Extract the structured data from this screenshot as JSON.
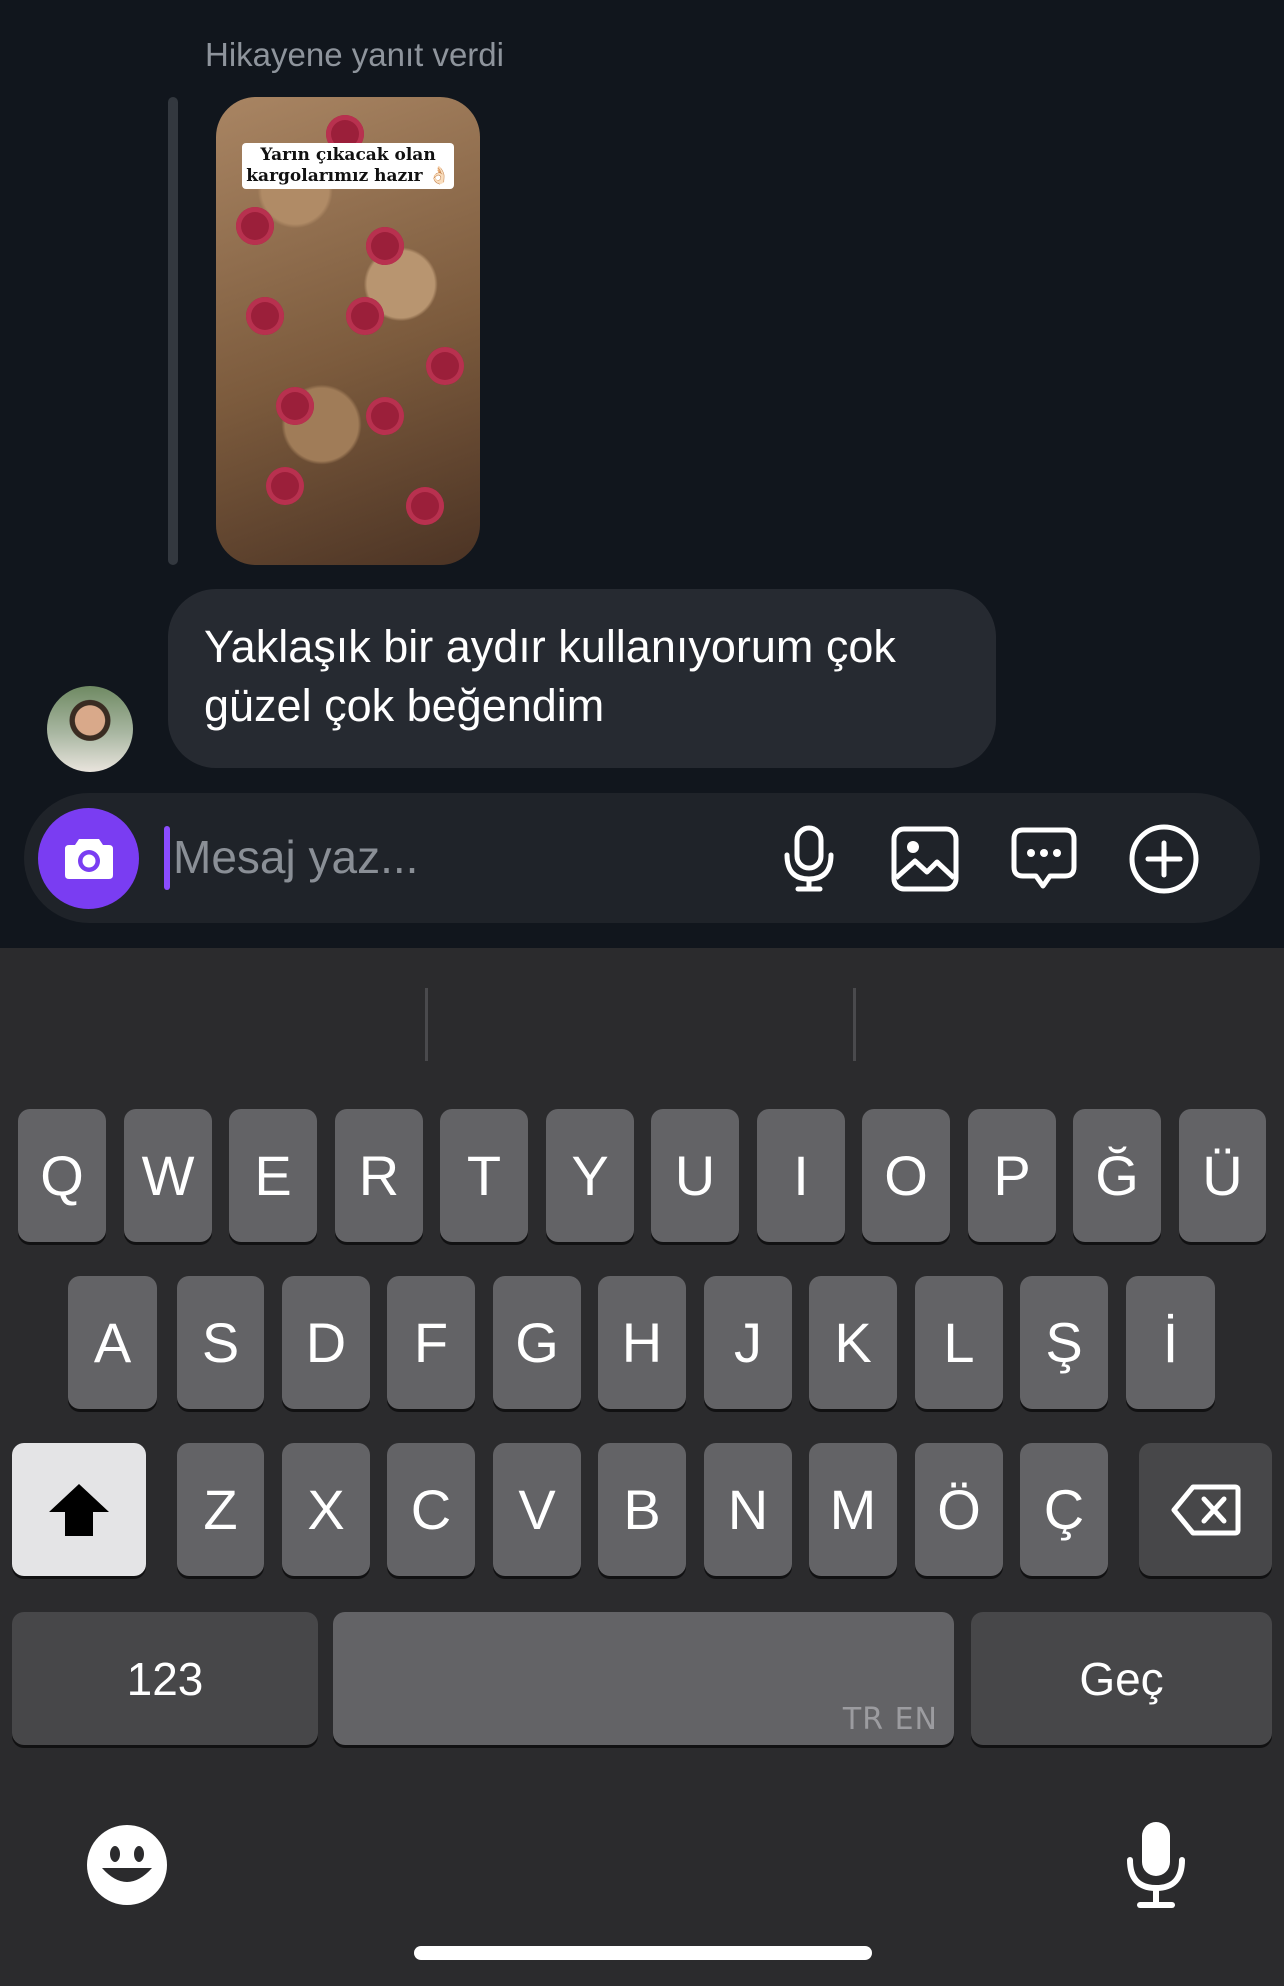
{
  "conversation": {
    "reply_label": "Hikayene yanıt verdi",
    "story_caption": "Yarın çıkacak olan kargolarımız hazır 👌🏻",
    "message_text": "Yaklaşık bir aydır kullanıyorum çok güzel çok beğendim"
  },
  "composer": {
    "placeholder": "Mesaj yaz...",
    "value": "",
    "camera_icon": "camera-icon",
    "tool_icons": [
      "microphone-icon",
      "image-icon",
      "chat-bubble-icon",
      "plus-circle-icon"
    ],
    "accent_color": "#7a3df2"
  },
  "keyboard": {
    "row1": [
      "Q",
      "W",
      "E",
      "R",
      "T",
      "Y",
      "U",
      "I",
      "O",
      "P",
      "Ğ",
      "Ü"
    ],
    "row2": [
      "A",
      "S",
      "D",
      "F",
      "G",
      "H",
      "J",
      "K",
      "L",
      "Ş",
      "İ"
    ],
    "row3": [
      "Z",
      "X",
      "C",
      "V",
      "B",
      "N",
      "M",
      "Ö",
      "Ç"
    ],
    "numbers_label": "123",
    "space_language": "TR EN",
    "return_label": "Geç",
    "shift_icon": "shift-icon",
    "delete_icon": "backspace-icon",
    "emoji_icon": "emoji-icon",
    "dictation_icon": "dictation-mic-icon"
  }
}
